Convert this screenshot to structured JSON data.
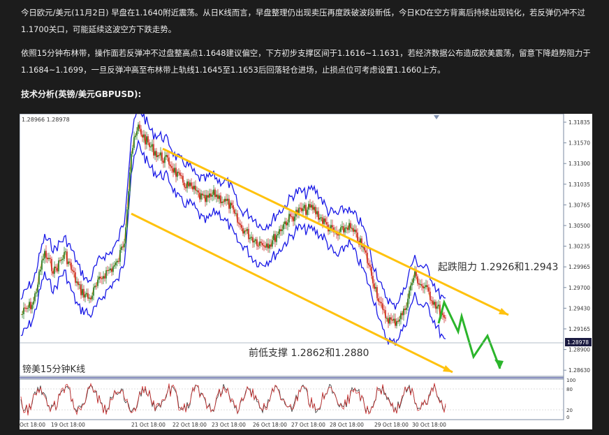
{
  "article": {
    "p1": "今日欧元/美元(11月2日) 早盘在1.1640附近震荡。从日K线而言，早盘整理仍出现卖压再度跌破波段新低，今日KD在空方背离后持续出现钝化，若反弹仍冲不过1.1700关口，可能延续这波空方下跌走势。",
    "p2": "依照15分钟布林带，操作面若反弹冲不过盘整高点1.1648建议偏空，下方初步支撑区间于1.1616~1.1631，若经济数据公布造成欧美震荡，留意下降趋势阻力于1.1684~1.1699，一旦反弹冲高至布林带上轨线1.1645至1.1653后回落轻仓进场，止损点位可考虑设置1.1660上方。",
    "heading": "技术分析(英镑/美元GBPUSD):"
  },
  "chart": {
    "top_readout": "1.28966 1.28978",
    "chart_label": "镑美15分钟K线",
    "resistance_note": "起跌阻力 1.2926和1.2943",
    "support_note": "前低支撑 1.2862和1.2880",
    "current_price": "1.28978",
    "price_ticks": [
      "1.31835",
      "1.31570",
      "1.31300",
      "1.31035",
      "1.30765",
      "1.30500",
      "1.30235",
      "1.29965",
      "1.29700",
      "1.29430",
      "1.29165",
      "1.28900",
      "1.28630"
    ],
    "osc_ticks": [
      "100",
      "80",
      "20",
      "0"
    ],
    "date_ticks": [
      "Oct 18:00",
      "19 Oct 18:00",
      "21 Oct 18:00",
      "22 Oct 18:00",
      "23 Oct 18:00",
      "26 Oct 18:00",
      "27 Oct 18:00",
      "28 Oct 18:00",
      "29 Oct 18:00",
      "30 Oct 18:00"
    ],
    "colors": {
      "bollinger": "#1a1ae6",
      "channel": "#ffc20e",
      "projection": "#2bb52b",
      "candle_up": "#1f7a1f",
      "candle_down": "#cc2020",
      "osc_k": "#333333",
      "osc_d": "#d03030"
    }
  }
}
